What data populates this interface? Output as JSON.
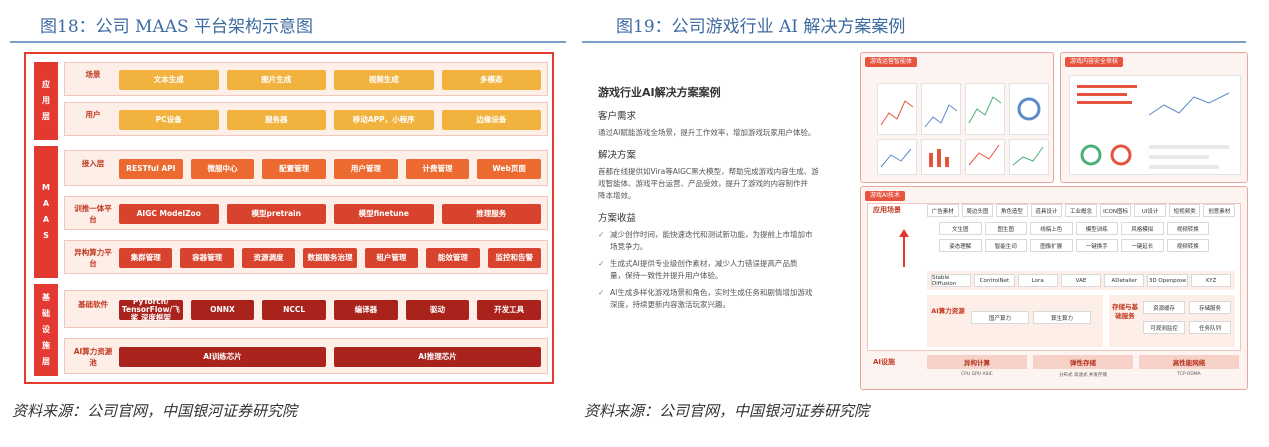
{
  "left_figure": {
    "title": "图18：公司 MAAS 平台架构示意图",
    "source": "资料来源：公司官网，中国银河证券研究院",
    "sections": [
      {
        "label": "应用层",
        "rows": [
          {
            "label": "场景",
            "color": "y",
            "chips": [
              "文本生成",
              "图片生成",
              "视频生成",
              "多模态"
            ]
          },
          {
            "label": "用户",
            "color": "y",
            "chips": [
              "PC设备",
              "服务器",
              "移动APP，小程序",
              "边缘设备"
            ]
          }
        ]
      },
      {
        "label": "MAAS",
        "rows": [
          {
            "label": "接入层",
            "color": "o",
            "chips": [
              "RESTful API",
              "微服中心",
              "配置管理",
              "用户管理",
              "计费管理",
              "Web页面"
            ]
          },
          {
            "label": "训推一体平台",
            "color": "r",
            "chips": [
              "AIGC ModelZoo",
              "模型pretrain",
              "模型finetune",
              "推理服务"
            ]
          },
          {
            "label": "异构算力平台",
            "color": "r",
            "chips": [
              "集群管理",
              "容器管理",
              "资源调度",
              "数据服务治理",
              "租户管理",
              "能效管理",
              "监控和告警"
            ]
          }
        ]
      },
      {
        "label": "基础设施层",
        "rows": [
          {
            "label": "基础软件",
            "color": "d",
            "chips": [
              "PyTorch/ TensorFlow/飞桨 深度框架",
              "ONNX",
              "NCCL",
              "编译器",
              "驱动",
              "开发工具"
            ]
          },
          {
            "label": "AI算力资源池",
            "color": "d",
            "chips": [
              "AI训练芯片",
              "AI推理芯片"
            ]
          }
        ]
      }
    ]
  },
  "right_figure": {
    "title": "图19：公司游戏行业 AI 解决方案案例",
    "source": "资料来源：公司官网，中国银河证券研究院",
    "case_title": "游戏行业AI解决方案案例",
    "need_title": "客户需求",
    "need_text": "通过AI赋能游戏全场景，提升工作效率，增加游戏玩家用户体验。",
    "solution_title": "解决方案",
    "solution_text": [
      "首都在线提供如Vira等AIGC黑大模型，帮助完成游戏内容生成、游",
      "戏智能体、游戏平台运营、产品受效，提升了游戏的内容制作并",
      "降本增效。"
    ],
    "benefit_title": "方案收益",
    "benefits": [
      [
        "减少创作时间，能快速迭代和测试新功能，为提前上市增加市",
        "场竞争力。"
      ],
      [
        "生成式AI提供专业级创作素材，减少人力错误提高产品质",
        "量，保持一致性并提升用户体验。"
      ],
      [
        "AI生成多样化游戏场景和角色，实时生成任务和剧情增加游戏",
        "深度，持续更新内容激活玩家兴趣。"
      ]
    ],
    "panel_top_left": "游戏运营智能体",
    "panel_top_right": "游戏内容安全审核",
    "panel_bottom": "游戏AI技术",
    "app_label": "应用场景",
    "app_chips": [
      [
        "广告素材",
        "周边头图",
        "角色造型",
        "道具设计",
        "工业概念",
        "ICON图标",
        "UI设计",
        "短视频类",
        "创意素材"
      ],
      [
        "文生图",
        "图生图",
        "线稿上色",
        "模型训练",
        "风格模拟",
        "视频转换"
      ],
      [
        "姿态理解",
        "智能生词",
        "图像扩展",
        "一键换手",
        "一键延长",
        "视频转换"
      ]
    ],
    "models": [
      "Stable Diffusion",
      "ControlNet",
      "Lora",
      "VAE",
      "ADetailer",
      "3D Openpose",
      "XYZ"
    ],
    "compute_label": "AI算力资源",
    "compute_chips": [
      "国产算力",
      "算生算力"
    ],
    "storage_label": "存储与基础服务",
    "storage_chips": [
      "资源缓存",
      "存储服务",
      "可观测监控",
      "任务队列"
    ],
    "infra_label": "AI设施",
    "infra": [
      {
        "name": "异构计算",
        "sub": "CPU GPU ASIC"
      },
      {
        "name": "弹性存储",
        "sub": "分布式 高速式 并发存储"
      },
      {
        "name": "高性能网络",
        "sub": "TCP RDMA"
      }
    ],
    "colors": {
      "accent": "#e23a31",
      "title_blue": "#3d6aa0"
    }
  }
}
